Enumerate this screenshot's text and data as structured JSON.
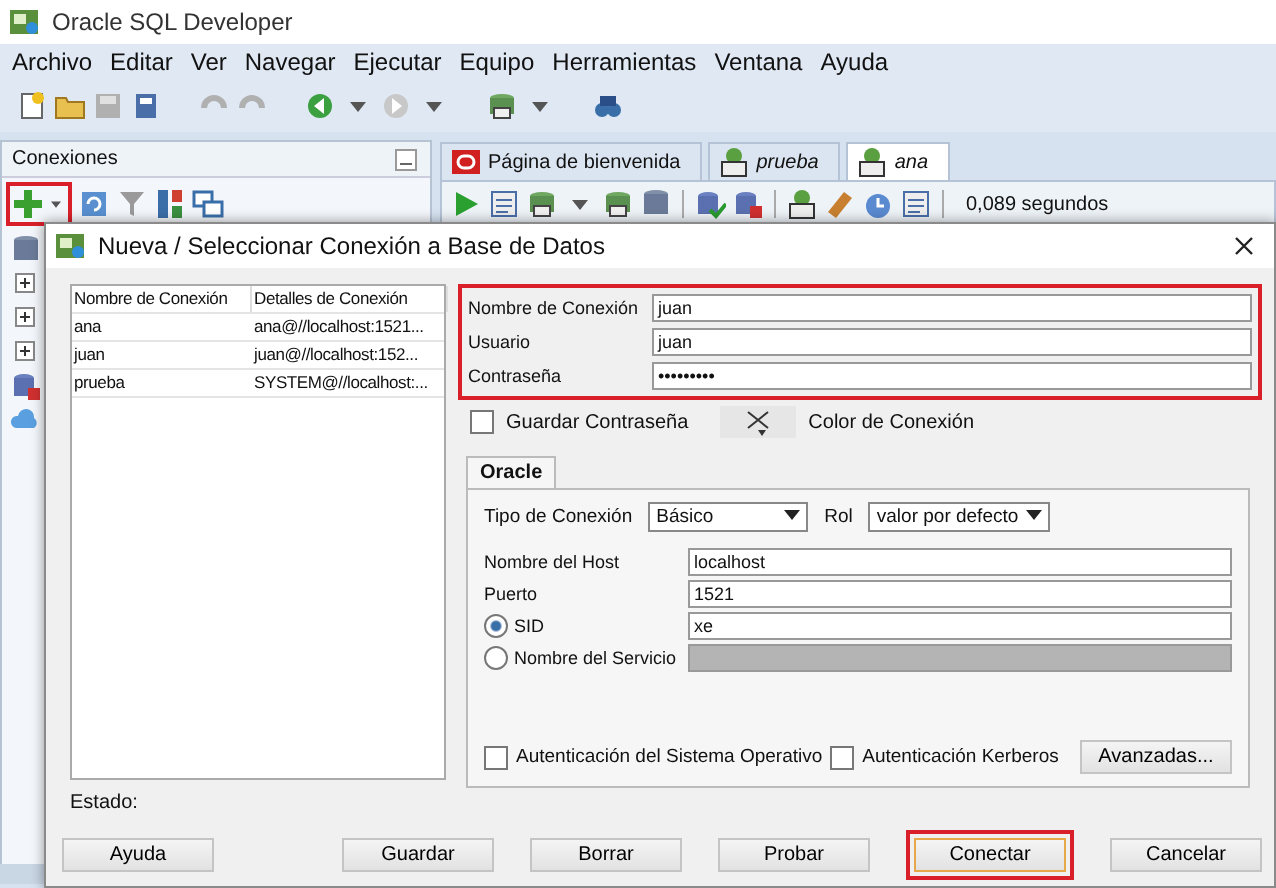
{
  "window": {
    "title": "Oracle SQL Developer"
  },
  "menu": [
    "Archivo",
    "Editar",
    "Ver",
    "Navegar",
    "Ejecutar",
    "Equipo",
    "Herramientas",
    "Ventana",
    "Ayuda"
  ],
  "connections_panel": {
    "title": "Conexiones"
  },
  "editor_tabs": [
    {
      "label": "Página de bienvenida",
      "selected": false,
      "kind": "welcome"
    },
    {
      "label": "prueba",
      "selected": false,
      "kind": "sql"
    },
    {
      "label": "ana",
      "selected": true,
      "kind": "sql"
    }
  ],
  "editor_toolbar": {
    "timing": "0,089 segundos"
  },
  "dialog": {
    "title": "Nueva / Seleccionar Conexión a Base de Datos",
    "table": {
      "columns": [
        "Nombre de Conexión",
        "Detalles de Conexión"
      ],
      "rows": [
        [
          "ana",
          "ana@//localhost:1521..."
        ],
        [
          "juan",
          "juan@//localhost:152..."
        ],
        [
          "prueba",
          "SYSTEM@//localhost:..."
        ]
      ]
    },
    "credentials": [
      {
        "label": "Nombre de Conexión",
        "value": "juan"
      },
      {
        "label": "Usuario",
        "value": "juan"
      },
      {
        "label": "Contraseña",
        "value": "•••••••••"
      }
    ],
    "save_password": {
      "label": "Guardar Contraseña",
      "checked": false
    },
    "color_label": "Color de Conexión",
    "tabs": [
      {
        "label": "Oracle",
        "selected": true
      }
    ],
    "connection_type": {
      "label": "Tipo de Conexión",
      "value": "Básico"
    },
    "role": {
      "label": "Rol",
      "value": "valor por defecto"
    },
    "settings": [
      {
        "kind": "text",
        "label": "Nombre del Host",
        "value": "localhost"
      },
      {
        "kind": "text",
        "label": "Puerto",
        "value": "1521"
      },
      {
        "kind": "radio",
        "label": "SID",
        "value": "xe",
        "selected": true,
        "disabled": false
      },
      {
        "kind": "radio",
        "label": "Nombre del Servicio",
        "selected": false,
        "disabled": true
      }
    ],
    "auth_options": [
      {
        "label": "Autenticación del Sistema Operativo",
        "checked": false
      },
      {
        "label": "Autenticación Kerberos",
        "checked": false
      }
    ],
    "advanced_button": "Avanzadas...",
    "status_label": "Estado:",
    "buttons": [
      {
        "label": "Ayuda",
        "highlighted": false
      },
      {
        "label": "Guardar",
        "highlighted": false
      },
      {
        "label": "Borrar",
        "highlighted": false
      },
      {
        "label": "Probar",
        "highlighted": false
      },
      {
        "label": "Conectar",
        "highlighted": true
      },
      {
        "label": "Cancelar",
        "highlighted": false
      }
    ]
  }
}
